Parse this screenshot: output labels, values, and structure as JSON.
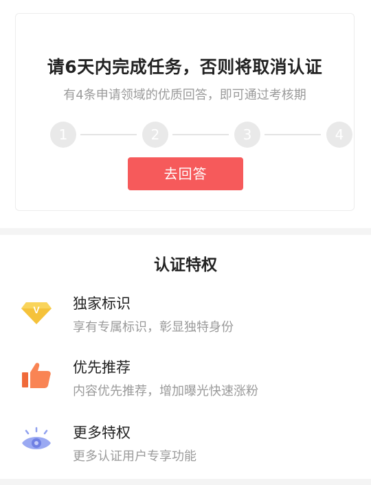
{
  "task_card": {
    "title": "请6天内完成任务，否则将取消认证",
    "subtitle": "有4条申请领域的优质回答，即可通过考核期",
    "steps": [
      "1",
      "2",
      "3",
      "4"
    ],
    "button_label": "去回答",
    "button_color": "#f65a5b"
  },
  "privileges": {
    "title": "认证特权",
    "items": [
      {
        "icon": "diamond-v-icon",
        "name": "独家标识",
        "desc": "享有专属标识，彰显独特身份"
      },
      {
        "icon": "thumbs-up-icon",
        "name": "优先推荐",
        "desc": "内容优先推荐，增加曝光快速涨粉"
      },
      {
        "icon": "eye-icon",
        "name": "更多特权",
        "desc": "更多认证用户专享功能"
      }
    ]
  }
}
